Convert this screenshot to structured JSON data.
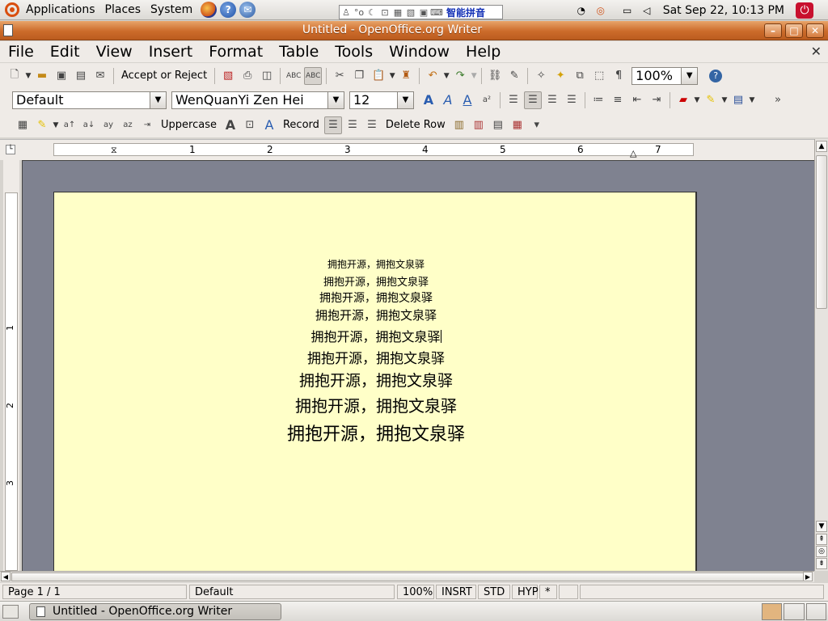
{
  "top_panel": {
    "menus": [
      "Applications",
      "Places",
      "System"
    ],
    "im_label": "智能拼音",
    "clock": "Sat Sep 22, 10:13 PM"
  },
  "window": {
    "title": "Untitled - OpenOffice.org Writer"
  },
  "menubar": {
    "items": [
      "File",
      "Edit",
      "View",
      "Insert",
      "Format",
      "Table",
      "Tools",
      "Window",
      "Help"
    ]
  },
  "toolbar1": {
    "accept_reject_label": "Accept or Reject",
    "zoom_value": "100%"
  },
  "toolbar2": {
    "style_value": "Default",
    "font_value": "WenQuanYi Zen Hei",
    "size_value": "12"
  },
  "toolbar3": {
    "uppercase_label": "Uppercase",
    "record_label": "Record",
    "delete_row_label": "Delete Row"
  },
  "ruler": {
    "numbers": [
      "1",
      "2",
      "3",
      "4",
      "5",
      "6",
      "7"
    ]
  },
  "vruler": {
    "numbers": [
      "1",
      "2",
      "3"
    ]
  },
  "document": {
    "lines": [
      "拥抱开源，拥抱文泉驿",
      "拥抱开源，拥抱文泉驿",
      "拥抱开源，拥抱文泉驿",
      "拥抱开源，拥抱文泉驿",
      "拥抱开源，拥抱文泉驿",
      "拥抱开源，拥抱文泉驿",
      "拥抱开源，拥抱文泉驿",
      "拥抱开源，拥抱文泉驿",
      "拥抱开源，拥抱文泉驿"
    ]
  },
  "statusbar": {
    "page": "Page 1 / 1",
    "style": "Default",
    "zoom": "100%",
    "insert_mode": "INSRT",
    "selection_mode": "STD",
    "hyperlink_mode": "HYP",
    "modified": "*"
  },
  "taskbar": {
    "task_label": "Untitled - OpenOffice.org Writer"
  }
}
